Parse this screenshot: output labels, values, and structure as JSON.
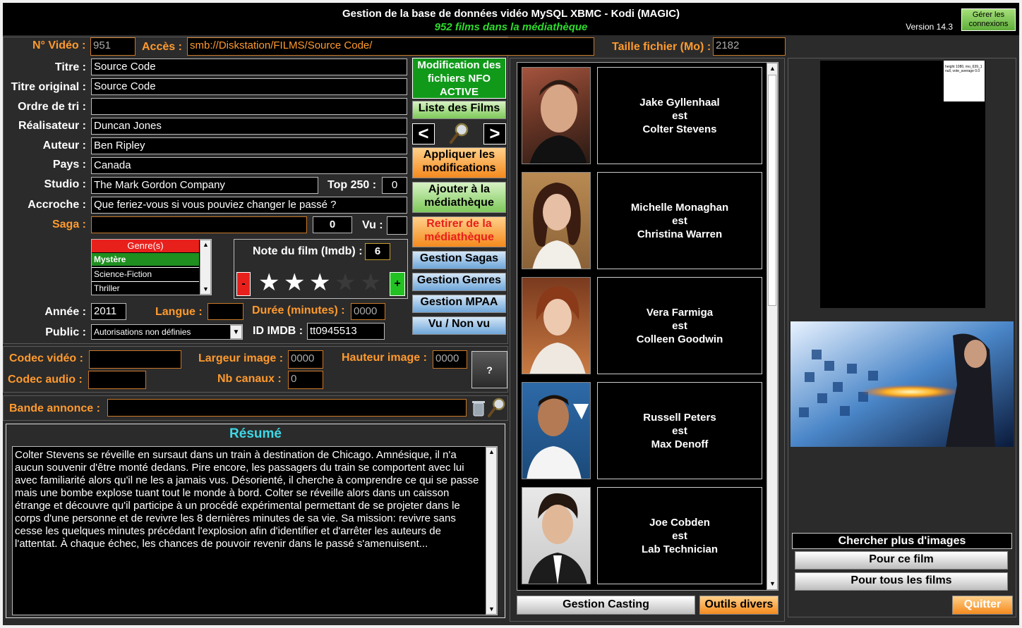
{
  "header": {
    "title": "Gestion de la base de données vidéo MySQL XBMC - Kodi (MAGIC)",
    "subtitle": "952 films dans la médiathèque",
    "version": "Version 14.3",
    "connections_button": "Gérer les connexions"
  },
  "top": {
    "video_no_label": "N° Vidéo :",
    "video_no": "951",
    "access_label": "Accès :",
    "access_path": "smb://Diskstation/FILMS/Source Code/",
    "filesize_label": "Taille fichier (Mo) :",
    "filesize": "2182"
  },
  "fields": {
    "titre_label": "Titre :",
    "titre": "Source Code",
    "titre_orig_label": "Titre original :",
    "titre_orig": "Source Code",
    "ordre_label": "Ordre de tri :",
    "ordre": "",
    "realisateur_label": "Réalisateur :",
    "realisateur": "Duncan Jones",
    "auteur_label": "Auteur :",
    "auteur": "Ben Ripley",
    "pays_label": "Pays :",
    "pays": "Canada",
    "studio_label": "Studio :",
    "studio": "The Mark Gordon Company",
    "top250_label": "Top 250 :",
    "top250": "0",
    "accroche_label": "Accroche :",
    "accroche": "Que feriez-vous si vous pouviez changer le passé ?",
    "saga_label": "Saga :",
    "saga": "",
    "saga_num": "0",
    "vu_label": "Vu :",
    "vu": ""
  },
  "genres": {
    "header": "Genre(s)",
    "items": [
      "Mystère",
      "Science-Fiction",
      "Thriller"
    ]
  },
  "rating": {
    "label": "Note du film (Imdb) :",
    "value": "6",
    "minus": "-",
    "plus": "+",
    "stars_filled": 3,
    "stars_total": 5
  },
  "meta": {
    "annee_label": "Année :",
    "annee": "2011",
    "langue_label": "Langue :",
    "langue": "",
    "duree_label": "Durée (minutes) :",
    "duree": "0000",
    "public_label": "Public :",
    "public": "Autorisations non définies",
    "imdb_label": "ID IMDB :",
    "imdb": "tt0945513"
  },
  "buttons": {
    "nfo": "Modification des fichiers NFO ACTIVE",
    "liste": "Liste des Films",
    "prev": "<",
    "next": ">",
    "appliquer": "Appliquer les modifications",
    "ajouter": "Ajouter à la médiathèque",
    "retirer": "Retirer de la médiathèque",
    "sagas": "Gestion Sagas",
    "genres": "Gestion Genres",
    "mpaa": "Gestion MPAA",
    "vu": "Vu / Non vu",
    "casting": "Gestion Casting",
    "outils": "Outils divers",
    "help": "?",
    "quitter": "Quitter"
  },
  "codec": {
    "video_label": "Codec vidéo :",
    "video": "",
    "audio_label": "Codec audio :",
    "audio": "",
    "largeur_label": "Largeur image :",
    "largeur": "0000",
    "hauteur_label": "Hauteur image :",
    "hauteur": "0000",
    "canaux_label": "Nb canaux :",
    "canaux": "0"
  },
  "trailer": {
    "label": "Bande annonce :",
    "value": ""
  },
  "resume": {
    "title": "Résumé",
    "text": "Colter Stevens se réveille en sursaut dans un train à destination de Chicago. Amnésique, il n'a aucun souvenir d'être monté dedans. Pire encore, les passagers du train se comportent avec lui avec familiarité alors qu'il ne les a jamais vus. Désorienté, il cherche à comprendre ce qui se passe mais une bombe explose tuant tout le monde à bord. Colter se réveille alors dans un caisson étrange et découvre qu'il participe à un procédé expérimental permettant de se projeter dans le corps d'une personne et de revivre les 8 dernières minutes de sa vie. Sa mission: revivre sans cesse les quelques minutes précédant l'explosion afin d'identifier et d'arrêter les auteurs de l'attentat. À chaque échec, les chances de pouvoir revenir dans le passé s'amenuisent..."
  },
  "cast": [
    {
      "actor": "Jake Gyllenhaal",
      "est": "est",
      "role": "Colter Stevens"
    },
    {
      "actor": "Michelle Monaghan",
      "est": "est",
      "role": "Christina Warren"
    },
    {
      "actor": "Vera Farmiga",
      "est": "est",
      "role": "Colleen Goodwin"
    },
    {
      "actor": "Russell Peters",
      "est": "est",
      "role": "Max Denoff"
    },
    {
      "actor": "Joe Cobden",
      "est": "est",
      "role": "Lab Technician"
    }
  ],
  "images": {
    "thumb_text": "height 1080, mo_639_1 null, vote_average 0.0",
    "search_title": "Chercher plus d'images",
    "this_film": "Pour ce film",
    "all_films": "Pour tous les films"
  },
  "colors": {
    "orange_label": "#ff9a2e",
    "green_subtitle": "#2edc2e",
    "resume_title": "#3fd7e6",
    "genre_header": "#e8201c",
    "genre_selected": "#1f8f1f"
  }
}
